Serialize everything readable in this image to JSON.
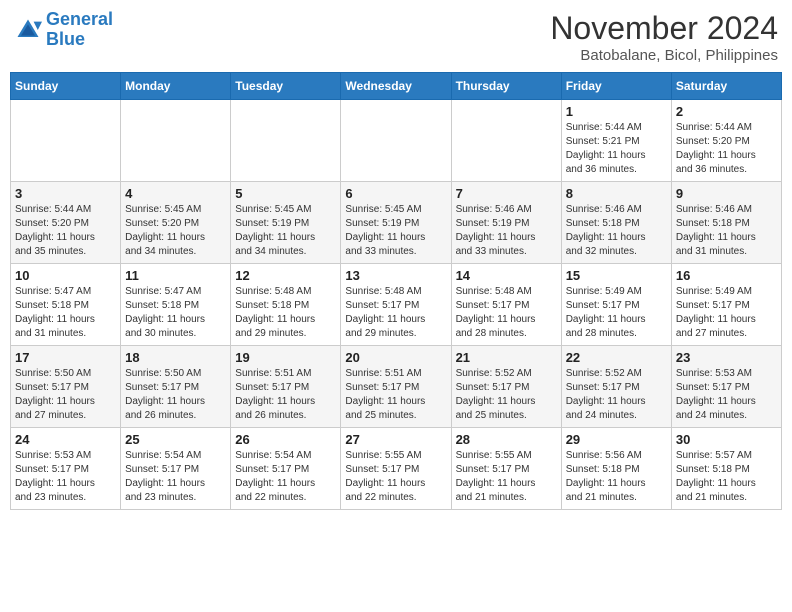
{
  "header": {
    "logo_line1": "General",
    "logo_line2": "Blue",
    "month": "November 2024",
    "location": "Batobalane, Bicol, Philippines"
  },
  "days_of_week": [
    "Sunday",
    "Monday",
    "Tuesday",
    "Wednesday",
    "Thursday",
    "Friday",
    "Saturday"
  ],
  "weeks": [
    [
      {
        "day": "",
        "info": ""
      },
      {
        "day": "",
        "info": ""
      },
      {
        "day": "",
        "info": ""
      },
      {
        "day": "",
        "info": ""
      },
      {
        "day": "",
        "info": ""
      },
      {
        "day": "1",
        "info": "Sunrise: 5:44 AM\nSunset: 5:21 PM\nDaylight: 11 hours\nand 36 minutes."
      },
      {
        "day": "2",
        "info": "Sunrise: 5:44 AM\nSunset: 5:20 PM\nDaylight: 11 hours\nand 36 minutes."
      }
    ],
    [
      {
        "day": "3",
        "info": "Sunrise: 5:44 AM\nSunset: 5:20 PM\nDaylight: 11 hours\nand 35 minutes."
      },
      {
        "day": "4",
        "info": "Sunrise: 5:45 AM\nSunset: 5:20 PM\nDaylight: 11 hours\nand 34 minutes."
      },
      {
        "day": "5",
        "info": "Sunrise: 5:45 AM\nSunset: 5:19 PM\nDaylight: 11 hours\nand 34 minutes."
      },
      {
        "day": "6",
        "info": "Sunrise: 5:45 AM\nSunset: 5:19 PM\nDaylight: 11 hours\nand 33 minutes."
      },
      {
        "day": "7",
        "info": "Sunrise: 5:46 AM\nSunset: 5:19 PM\nDaylight: 11 hours\nand 33 minutes."
      },
      {
        "day": "8",
        "info": "Sunrise: 5:46 AM\nSunset: 5:18 PM\nDaylight: 11 hours\nand 32 minutes."
      },
      {
        "day": "9",
        "info": "Sunrise: 5:46 AM\nSunset: 5:18 PM\nDaylight: 11 hours\nand 31 minutes."
      }
    ],
    [
      {
        "day": "10",
        "info": "Sunrise: 5:47 AM\nSunset: 5:18 PM\nDaylight: 11 hours\nand 31 minutes."
      },
      {
        "day": "11",
        "info": "Sunrise: 5:47 AM\nSunset: 5:18 PM\nDaylight: 11 hours\nand 30 minutes."
      },
      {
        "day": "12",
        "info": "Sunrise: 5:48 AM\nSunset: 5:18 PM\nDaylight: 11 hours\nand 29 minutes."
      },
      {
        "day": "13",
        "info": "Sunrise: 5:48 AM\nSunset: 5:17 PM\nDaylight: 11 hours\nand 29 minutes."
      },
      {
        "day": "14",
        "info": "Sunrise: 5:48 AM\nSunset: 5:17 PM\nDaylight: 11 hours\nand 28 minutes."
      },
      {
        "day": "15",
        "info": "Sunrise: 5:49 AM\nSunset: 5:17 PM\nDaylight: 11 hours\nand 28 minutes."
      },
      {
        "day": "16",
        "info": "Sunrise: 5:49 AM\nSunset: 5:17 PM\nDaylight: 11 hours\nand 27 minutes."
      }
    ],
    [
      {
        "day": "17",
        "info": "Sunrise: 5:50 AM\nSunset: 5:17 PM\nDaylight: 11 hours\nand 27 minutes."
      },
      {
        "day": "18",
        "info": "Sunrise: 5:50 AM\nSunset: 5:17 PM\nDaylight: 11 hours\nand 26 minutes."
      },
      {
        "day": "19",
        "info": "Sunrise: 5:51 AM\nSunset: 5:17 PM\nDaylight: 11 hours\nand 26 minutes."
      },
      {
        "day": "20",
        "info": "Sunrise: 5:51 AM\nSunset: 5:17 PM\nDaylight: 11 hours\nand 25 minutes."
      },
      {
        "day": "21",
        "info": "Sunrise: 5:52 AM\nSunset: 5:17 PM\nDaylight: 11 hours\nand 25 minutes."
      },
      {
        "day": "22",
        "info": "Sunrise: 5:52 AM\nSunset: 5:17 PM\nDaylight: 11 hours\nand 24 minutes."
      },
      {
        "day": "23",
        "info": "Sunrise: 5:53 AM\nSunset: 5:17 PM\nDaylight: 11 hours\nand 24 minutes."
      }
    ],
    [
      {
        "day": "24",
        "info": "Sunrise: 5:53 AM\nSunset: 5:17 PM\nDaylight: 11 hours\nand 23 minutes."
      },
      {
        "day": "25",
        "info": "Sunrise: 5:54 AM\nSunset: 5:17 PM\nDaylight: 11 hours\nand 23 minutes."
      },
      {
        "day": "26",
        "info": "Sunrise: 5:54 AM\nSunset: 5:17 PM\nDaylight: 11 hours\nand 22 minutes."
      },
      {
        "day": "27",
        "info": "Sunrise: 5:55 AM\nSunset: 5:17 PM\nDaylight: 11 hours\nand 22 minutes."
      },
      {
        "day": "28",
        "info": "Sunrise: 5:55 AM\nSunset: 5:17 PM\nDaylight: 11 hours\nand 21 minutes."
      },
      {
        "day": "29",
        "info": "Sunrise: 5:56 AM\nSunset: 5:18 PM\nDaylight: 11 hours\nand 21 minutes."
      },
      {
        "day": "30",
        "info": "Sunrise: 5:57 AM\nSunset: 5:18 PM\nDaylight: 11 hours\nand 21 minutes."
      }
    ]
  ]
}
